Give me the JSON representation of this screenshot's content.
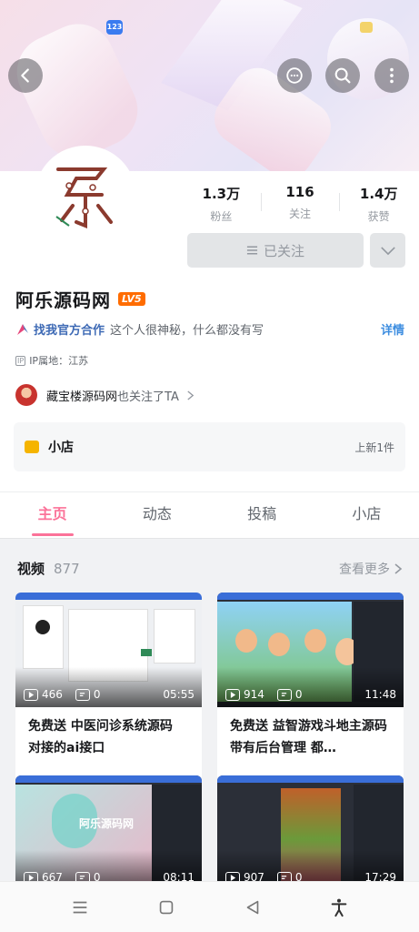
{
  "status": {
    "badge_left": "123"
  },
  "header": {
    "actions": [
      "back-icon",
      "message-icon",
      "search-icon",
      "more-vertical-icon"
    ]
  },
  "profile": {
    "stats": [
      {
        "value": "1.3万",
        "label": "粉丝"
      },
      {
        "value": "116",
        "label": "关注"
      },
      {
        "value": "1.4万",
        "label": "获赞"
      }
    ],
    "follow_label": "已关注",
    "name": "阿乐源码网",
    "level": "LV5",
    "cooperation_label": "找我官方合作",
    "signature": "这个人很神秘，什么都没有写",
    "detail_label": "详情",
    "ip_tag": "IP",
    "ip_location": "IP属地：江苏",
    "mutual_user": "藏宝楼源码网",
    "mutual_suffix": "也关注了TA",
    "shop_title": "小店",
    "shop_new": "上新1件"
  },
  "tabs": [
    "主页",
    "动态",
    "投稿",
    "小店"
  ],
  "videos_section": {
    "title": "视频",
    "count": "877",
    "more_label": "查看更多"
  },
  "videos": [
    {
      "plays": "466",
      "danmaku": "0",
      "duration": "05:55",
      "title": "免费送 中医问诊系统源码 对接的ai接口"
    },
    {
      "plays": "914",
      "danmaku": "0",
      "duration": "11:48",
      "title": "免费送 益智游戏斗地主源码带有后台管理 都…"
    },
    {
      "plays": "667",
      "danmaku": "0",
      "duration": "08:11",
      "title": ""
    },
    {
      "plays": "907",
      "danmaku": "0",
      "duration": "17:29",
      "title": ""
    }
  ],
  "thumb_overlay": "阿乐源码网",
  "colors": {
    "accent": "#fb7299",
    "link": "#3e8ee0",
    "level": "#ff6c00"
  }
}
